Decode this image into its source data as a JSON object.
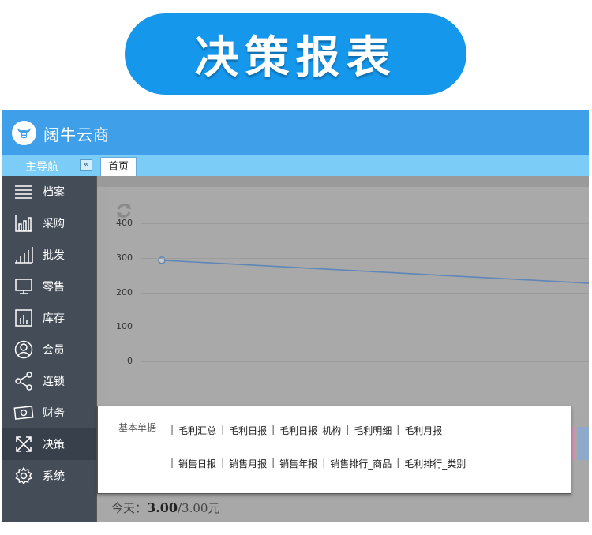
{
  "banner": {
    "title": "决策报表"
  },
  "app": {
    "name": "阔牛云商"
  },
  "subbar": {
    "nav_title": "主导航",
    "collapse_symbol": "«",
    "tab_home": "首页"
  },
  "sidebar": {
    "items": [
      {
        "label": "档案",
        "icon": "list-icon"
      },
      {
        "label": "采购",
        "icon": "bar-chart-icon"
      },
      {
        "label": "批发",
        "icon": "rising-bars-icon"
      },
      {
        "label": "零售",
        "icon": "monitor-icon"
      },
      {
        "label": "库存",
        "icon": "inventory-bars-icon"
      },
      {
        "label": "会员",
        "icon": "user-icon"
      },
      {
        "label": "连锁",
        "icon": "share-icon"
      },
      {
        "label": "财务",
        "icon": "money-icon"
      },
      {
        "label": "决策",
        "icon": "arrows-out-icon",
        "active": true
      },
      {
        "label": "系统",
        "icon": "gear-icon"
      }
    ]
  },
  "chart_data": {
    "type": "line",
    "y_ticks": [
      "400",
      "300",
      "200",
      "100",
      "0"
    ],
    "ylim": [
      0,
      400
    ],
    "series": [
      {
        "values": [
          293,
          226
        ]
      }
    ],
    "line_color": "#5f86b8"
  },
  "popup": {
    "category": "基本单据",
    "row1": [
      "毛利汇总",
      "毛利日报",
      "毛利日报_机构",
      "毛利明细",
      "毛利月报"
    ],
    "row2": [
      "销售日报",
      "销售月报",
      "销售年报",
      "销售排行_商品",
      "毛利排行_类别"
    ]
  },
  "footer": {
    "today_label": "今天：",
    "today_value": "3.00",
    "today_total": "/3.00元"
  }
}
